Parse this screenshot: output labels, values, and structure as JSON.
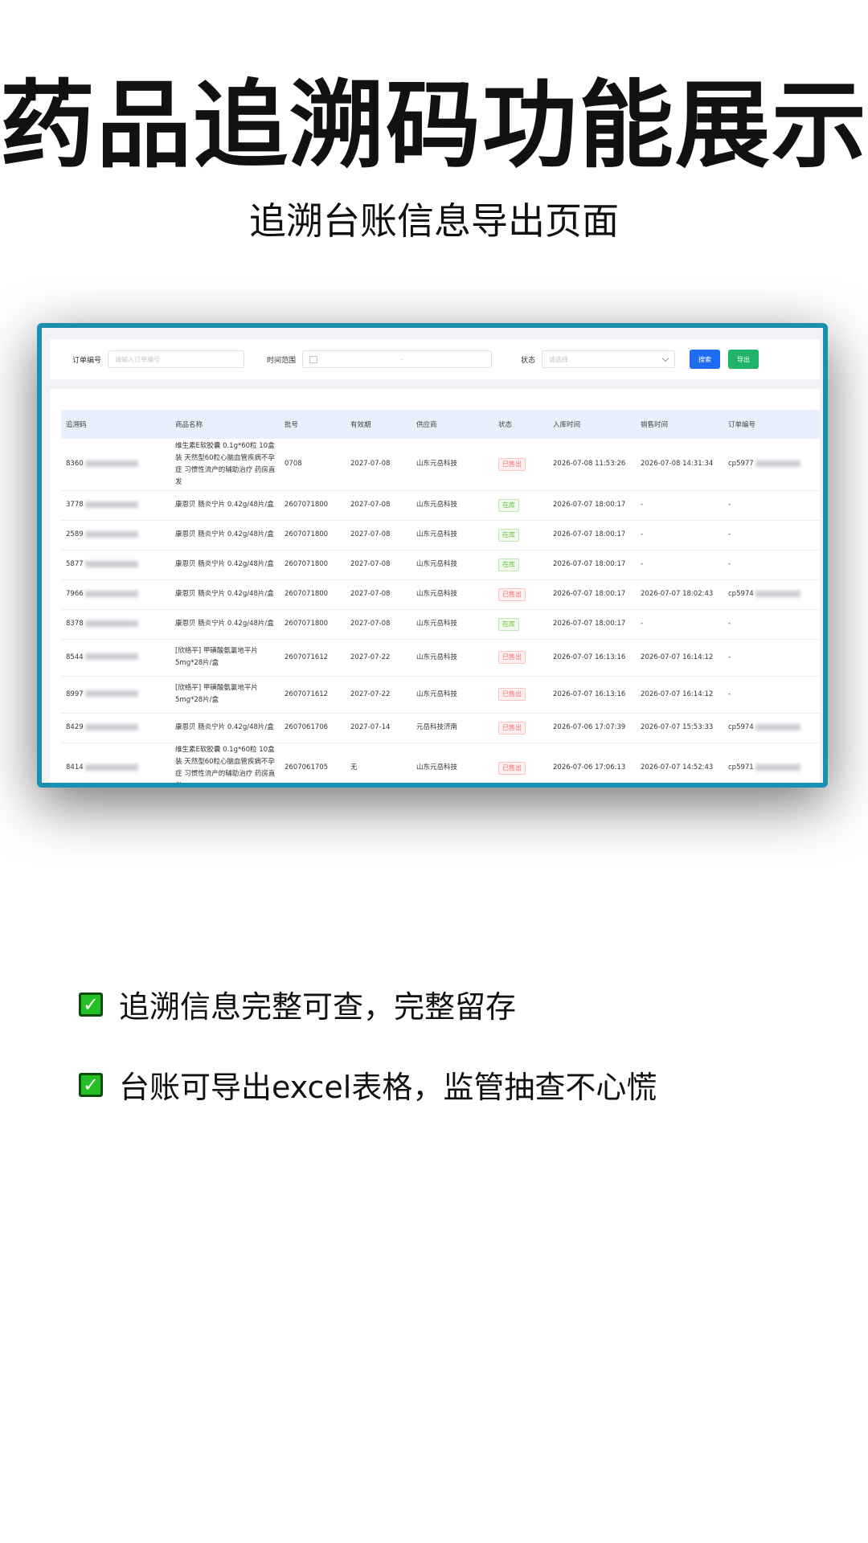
{
  "headline": "药品追溯码功能展示",
  "subheadline": "追溯台账信息导出页面",
  "filters": {
    "order_label": "订单编号",
    "order_placeholder": "请输入订单编号",
    "range_label": "时间范围",
    "range_sep": "-",
    "status_label": "状态",
    "status_placeholder": "请选择",
    "search_btn": "搜索",
    "export_btn": "导出"
  },
  "table": {
    "headers": [
      "追溯码",
      "商品名称",
      "批号",
      "有效期",
      "供应商",
      "状态",
      "入库时间",
      "销售时间",
      "订单编号"
    ],
    "rows": [
      {
        "code": "8360",
        "name": "维生素E软胶囊 0.1g*60粒 10盒装 天然型60粒心脑血管疾病不孕症 习惯性流产的辅助治疗 药房直发",
        "batch": "0708",
        "expiry": "2027-07-08",
        "supplier": "山东元岳科技",
        "status": "已售出",
        "in_time": "2026-07-08 11:53:26",
        "sale_time": "2026-07-08 14:31:34",
        "order": "cp5977"
      },
      {
        "code": "3778",
        "name": "康恩贝 肠炎宁片 0.42g/48片/盒",
        "batch": "2607071800",
        "expiry": "2027-07-08",
        "supplier": "山东元岳科技",
        "status": "在库",
        "in_time": "2026-07-07 18:00:17",
        "sale_time": "-",
        "order": "-"
      },
      {
        "code": "2589",
        "name": "康恩贝 肠炎宁片 0.42g/48片/盒",
        "batch": "2607071800",
        "expiry": "2027-07-08",
        "supplier": "山东元岳科技",
        "status": "在库",
        "in_time": "2026-07-07 18:00:17",
        "sale_time": "-",
        "order": "-"
      },
      {
        "code": "5877",
        "name": "康恩贝 肠炎宁片 0.42g/48片/盒",
        "batch": "2607071800",
        "expiry": "2027-07-08",
        "supplier": "山东元岳科技",
        "status": "在库",
        "in_time": "2026-07-07 18:00:17",
        "sale_time": "-",
        "order": "-"
      },
      {
        "code": "7966",
        "name": "康恩贝 肠炎宁片 0.42g/48片/盒",
        "batch": "2607071800",
        "expiry": "2027-07-08",
        "supplier": "山东元岳科技",
        "status": "已售出",
        "in_time": "2026-07-07 18:00:17",
        "sale_time": "2026-07-07 18:02:43",
        "order": "cp5974"
      },
      {
        "code": "8378",
        "name": "康恩贝 肠炎宁片 0.42g/48片/盒",
        "batch": "2607071800",
        "expiry": "2027-07-08",
        "supplier": "山东元岳科技",
        "status": "在库",
        "in_time": "2026-07-07 18:00:17",
        "sale_time": "-",
        "order": "-"
      },
      {
        "code": "8544",
        "name": "[欣络平] 甲磺酸氨氯地平片5mg*28片/盒",
        "batch": "2607071612",
        "expiry": "2027-07-22",
        "supplier": "山东元岳科技",
        "status": "已售出",
        "in_time": "2026-07-07 16:13:16",
        "sale_time": "2026-07-07 16:14:12",
        "order": "-"
      },
      {
        "code": "8997",
        "name": "[欣络平] 甲磺酸氨氯地平片5mg*28片/盒",
        "batch": "2607071612",
        "expiry": "2027-07-22",
        "supplier": "山东元岳科技",
        "status": "已售出",
        "in_time": "2026-07-07 16:13:16",
        "sale_time": "2026-07-07 16:14:12",
        "order": "-"
      },
      {
        "code": "8429",
        "name": "康恩贝 肠炎宁片 0.42g/48片/盒",
        "batch": "2607061706",
        "expiry": "2027-07-14",
        "supplier": "元岳科技济南",
        "status": "已售出",
        "in_time": "2026-07-06 17:07:39",
        "sale_time": "2026-07-07 15:53:33",
        "order": "cp5974"
      },
      {
        "code": "8414",
        "name": "维生素E软胶囊 0.1g*60粒 10盒装 天然型60粒心脑血管疾病不孕症 习惯性流产的辅助治疗 药房直发",
        "batch": "2607061705",
        "expiry": "无",
        "supplier": "山东元岳科技",
        "status": "已售出",
        "in_time": "2026-07-06 17:06:13",
        "sale_time": "2026-07-07 14:52:43",
        "order": "cp5971"
      }
    ]
  },
  "features": [
    {
      "text": "追溯信息完整可查，完整留存"
    },
    {
      "text": "台账可导出excel表格，监管抽查不心慌"
    }
  ],
  "colors": {
    "accent": "#1e6cf0",
    "export": "#1fb36b",
    "sold": "#f56c6c",
    "stock": "#67c23a",
    "frame": "#1b8fb0"
  }
}
